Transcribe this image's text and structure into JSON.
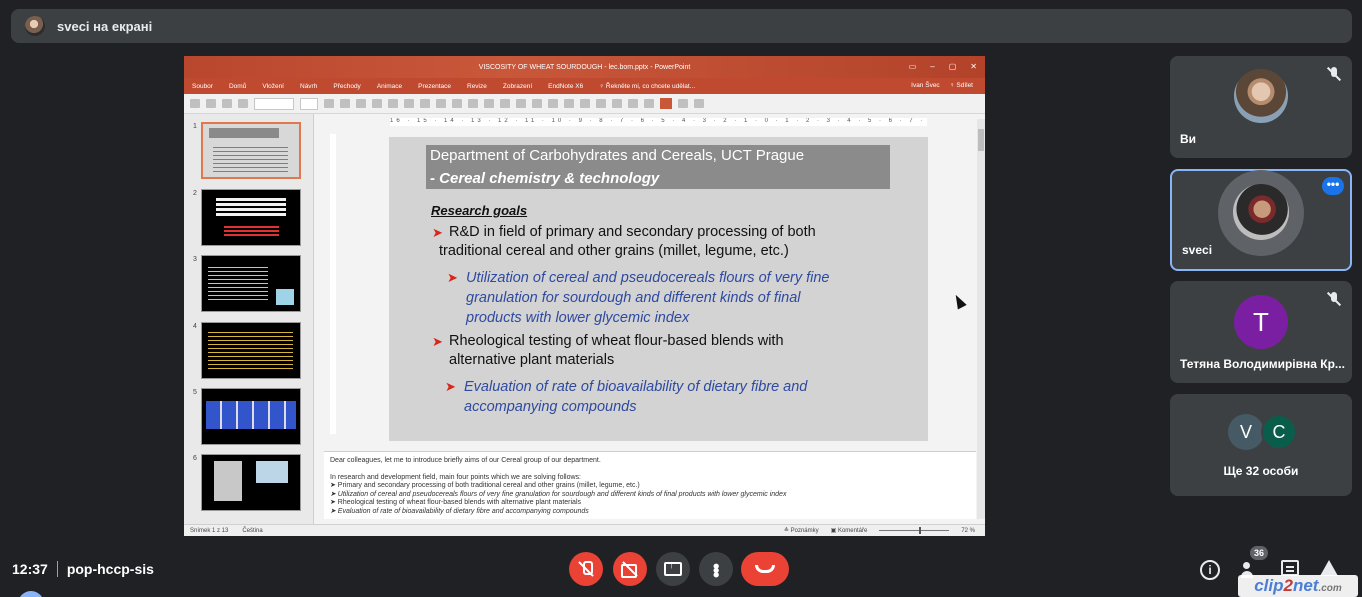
{
  "top_banner": {
    "title": "sveci на екрані",
    "avatar_icon": "presenter-avatar"
  },
  "powerpoint": {
    "window_title": "VISCOSITY OF WHEAT SOURDOUGH - lec.bom.pptx - PowerPoint",
    "window_controls": [
      "▭",
      "–",
      "▢",
      "✕"
    ],
    "ribbon_tabs": [
      "Soubor",
      "Domů",
      "Vložení",
      "Návrh",
      "Přechody",
      "Animace",
      "Prezentace",
      "Revize",
      "Zobrazení",
      "EndNote X6",
      "♀ Řekněte mi, co chcete udělat..."
    ],
    "user": "Ivan Švec",
    "share_label": "♀ Sdílet",
    "ruler_text": "16 · 15 · 14 · 13 · 12 · 11 · 10 · 9 · 8 · 7 · 6 · 5 · 4 · 3 · 2 · 1 · 0 · 1 · 2 · 3 · 4 · 5 · 6 · 7 · 8 · 9 · 10 · 11 · 12 · 13 · 14 · 15 · 16",
    "thumb_numbers": [
      "1",
      "2",
      "3",
      "4",
      "5",
      "6"
    ],
    "slide": {
      "header_line1": "Department of Carbohydrates and Cereals, UCT Prague",
      "header_line2": "- Cereal chemistry & technology",
      "goals_title": "Research goals",
      "bullet1_l1": "R&D in field of primary and secondary processing of both",
      "bullet1_l2": "traditional cereal and other grains (millet, legume, etc.)",
      "sub1_l1": "Utilization of cereal and pseudocereals flours of very fine",
      "sub1_l2": "granulation for sourdough and different kinds of final",
      "sub1_l3": "products with lower glycemic index",
      "bullet2_l1": "Rheological testing of wheat flour-based blends with",
      "bullet2_l2": "alternative plant materials",
      "sub2_l1": "Evaluation of rate of bioavailability of dietary fibre and",
      "sub2_l2": "accompanying compounds",
      "arrow": "➤"
    },
    "notes": {
      "intro": "Dear colleagues, let me to introduce briefly aims of our Cereal group of our department.",
      "line1": "In research and development field, main four points which we are solving follows:",
      "line2": "➤ Primary and secondary processing of both traditional cereal and other grains (millet, legume, etc.)",
      "line3": "➤ Utilization of cereal and pseudocereals flours of very fine granulation for sourdough and different kinds of final products with lower glycemic index",
      "line4": "➤ Rheological testing of wheat flour-based blends with alternative plant materials",
      "line5": "➤ Evaluation of rate of bioavailability of dietary fibre and accompanying compounds"
    },
    "status": {
      "slide_counter": "Snímek 1 z 13",
      "language": "Čeština",
      "notes_btn": "≜ Poznámky",
      "comments_btn": "▣ Komentáře",
      "zoom": "72 %"
    }
  },
  "participants": [
    {
      "name": "Ви",
      "muted": true
    },
    {
      "name": "sveci",
      "muted": false,
      "more": "•••"
    },
    {
      "name": "Тетяна Володимирівна Кр...",
      "initial": "T",
      "muted": true
    },
    {
      "label": "Ще 32 особи",
      "initials": [
        "V",
        "C"
      ]
    }
  ],
  "bottom": {
    "time": "12:37",
    "meeting_code": "pop-hccp-sis",
    "people_count": "36",
    "info_glyph": "i"
  },
  "watermark": {
    "part1": "clip",
    "part2": "2",
    "part3": "net",
    "suffix": ".com"
  },
  "colors": {
    "meet_bg": "#202124",
    "tile_bg": "#3c4043",
    "red": "#ea4335",
    "active_border": "#8ab4f8",
    "pp_accent": "#c04a30"
  }
}
